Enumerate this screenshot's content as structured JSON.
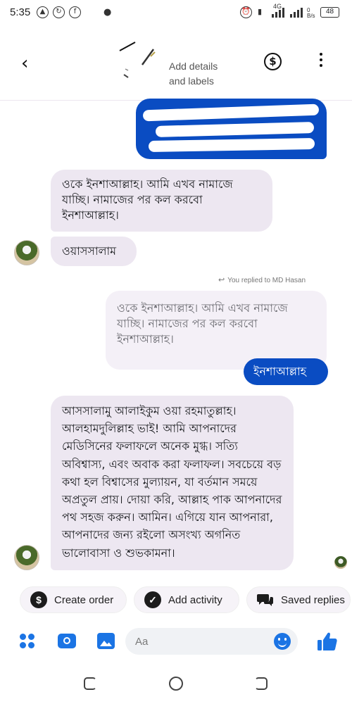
{
  "status_bar": {
    "time": "5:35",
    "network_label": "4G",
    "data_speed": "0 B/s",
    "battery": "48"
  },
  "header": {
    "add_details": "Add details",
    "and_labels": "and labels",
    "icons": [
      "back-arrow-icon",
      "dollar-icon",
      "more-vertical-icon"
    ]
  },
  "messages": {
    "incoming_1": "ওকে ইনশাআল্লাহ। আমি এখব নামাজে যাচ্ছি। নামাজের পর কল করবো ইনশাআল্লাহ।",
    "incoming_2": "ওয়াসসালাম",
    "replied_to": "You replied to MD Hasan",
    "quoted": "ওকে ইনশাআল্লাহ। আমি এখব নামাজে যাচ্ছি। নামাজের পর কল করবো ইনশাআল্লাহ।",
    "outgoing_reply": "ইনশাআল্লাহ",
    "incoming_3": "আসসালামু আলাইকুম ওয়া রহমাতুল্লাহ। আলহামদুলিল্লাহ ভাই! আমি আপনাদের মেডিসিনের ফলাফলে অনেক মুগ্ধ। সত্যি অবিশ্বাস্য, এবং অবাক করা ফলাফল। সবচেয়ে বড় কথা হল বিশ্বাসের মুল্যায়ন, যা বর্তমান সময়ে অপ্রতুল প্রায়। দোয়া করি, আল্লাহ পাক আপনাদের পথ সহজ করুন। আমিন। এগিয়ে যান আপনারা, আপনাদের জন্য রইলো অসংখ্য অগনিত ভালোবাসা ও শুভকামনা।"
  },
  "actions": {
    "create_order": "Create order",
    "add_activity": "Add activity",
    "saved_replies": "Saved replies"
  },
  "composer": {
    "placeholder": "Aa"
  },
  "colors": {
    "messenger_blue": "#1b74e4",
    "outgoing_bubble": "#0a4cc2",
    "incoming_bubble": "#ede7f1"
  }
}
